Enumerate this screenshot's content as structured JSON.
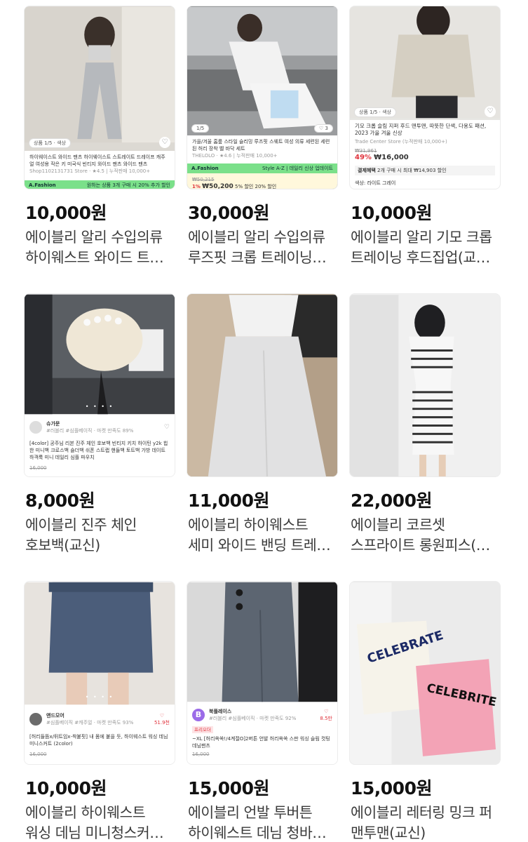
{
  "products": [
    {
      "price": "10,000원",
      "title_line1": "에이블리 알리 수입의류",
      "title_line2": "하이웨스트 와이드 트…",
      "thumb": {
        "badge": "상품 1/5",
        "badge_sub": "색상",
        "desc": "하이웨이스트 와이드 팬츠 하이웨이스트 스트레이트 드레이프 캐주얼 여성용 작은 키 미국식 빈티지 와이드 팬츠 와이드 팬츠",
        "shop": "Shop1102131731 Store",
        "rating": "4.5",
        "sold": "누적판매 10,000+",
        "bar_left": "A.Fashion",
        "bar_right": "원하는 상품 3개 구매 시 20% 추가 할인"
      },
      "colors": {
        "bg": "#d9d6d0",
        "fg": "#b9bcc0"
      }
    },
    {
      "price": "30,000원",
      "title_line1": "에이블리 알리 수입의류",
      "title_line2": "루즈핏 크롭 트레이닝…",
      "thumb": {
        "badge": "1/5",
        "likes": "3",
        "desc": "가을/겨울 홈룸 스타일 슬리밍 루즈핏 스웨트 여성 의류 세련된 세련된 허리 장착 벨 바닥 세트",
        "shop": "THELOLO",
        "rating": "4.6",
        "sold": "누적판매 10,000+",
        "bar_left": "A.Fashion",
        "bar_right": "Style A-Z | 데일리 신상 업데이트",
        "old_price": "₩50,215",
        "discount": "1%",
        "new_price": "₩50,200",
        "coupon": "5% 할인",
        "coupon2": "20% 할인"
      },
      "colors": {
        "bg": "#8d8f91",
        "fg": "#ececec"
      }
    },
    {
      "price": "10,000원",
      "title_line1": "에이블리 알리 기모 크롭",
      "title_line2": "트레이닝 후드집업(교…",
      "thumb": {
        "badge": "상품 1/5",
        "badge_sub": "색상",
        "desc": "기모 크롭 슬림 지퍼 후드 맨투맨, 따뜻한 단색, 다용도 패션, 2023 가을 겨울 신상",
        "shop": "Trade Center Store",
        "sold": "누적판매 10,000+",
        "old_price": "₩31,961",
        "discount": "49%",
        "new_price": "₩16,000",
        "promo": "결제혜택",
        "promo_detail": "2개 구매 시 최대 ₩14,903 할인",
        "color_label": "색상: 라이트 그레이"
      },
      "colors": {
        "bg": "#e8e7e4",
        "fg": "#d6d0c4"
      }
    },
    {
      "price": "8,000원",
      "title_line1": "에이블리 진주 체인",
      "title_line2": "호보백(교신)",
      "thumb": {
        "shop": "슈가문",
        "tags": "#러블리 #심플베이직 · 마켓 만족도 89%",
        "desc": "[4color] 공주님 리본 진주 체인 호보백 빈티지 키치 하이틴 y2k 힙한 미니백 크로스백 숄더백 쉬폰 스트랩 핸들백 토트백 가방 데이트 하객룩 미니 데일리 심플 파우치",
        "old_price": "16,000"
      },
      "colors": {
        "bg": "#3b3d41",
        "fg": "#efe9dc"
      }
    },
    {
      "price": "11,000원",
      "title_line1": "에이블리 하이웨스트",
      "title_line2": "세미 와이드 밴딩 트레…",
      "thumb": {},
      "colors": {
        "bg": "#c9b69f",
        "fg": "#e4e4e4"
      }
    },
    {
      "price": "22,000원",
      "title_line1": "에이블리 코르셋",
      "title_line2": "스프라이트 롱원피스(…",
      "thumb": {},
      "colors": {
        "bg": "#f1f1f1",
        "fg": "#3a3a3a"
      }
    },
    {
      "price": "10,000원",
      "title_line1": "에이블리 하이웨스트",
      "title_line2": "워싱 데님 미니청스커…",
      "thumb": {
        "shop": "앤드모어",
        "tags": "#심플베이직 #캐주얼 · 마켓 만족도 93%",
        "likes": "51.9천",
        "desc": "[허리들뜸x/뒤트임x-착붙핏] 내 몸에 붙을 듯, 하이웨스트 워싱 데님 미니스커트 (2color)",
        "old_price": "16,000"
      },
      "colors": {
        "bg": "#e6e3df",
        "fg": "#4a5c78"
      }
    },
    {
      "price": "15,000원",
      "title_line1": "에이블리 언발 투버튼",
      "title_line2": "하이웨스트 데님 청바…",
      "thumb": {
        "shop": "북플레이스",
        "tags": "#러블리 #심플베이직 · 마켓 만족도 92%",
        "likes": "8.5만",
        "label": "프리오더",
        "desc": "~XL [허리쏙쏙!/4계절O]2버튼 언발 허리쏙쏙 스판 워싱 슬림 컷팅 데님팬츠",
        "old_price": "16,000"
      },
      "colors": {
        "bg": "#d8d8d8",
        "fg": "#5b6470"
      }
    },
    {
      "price": "15,000원",
      "title_line1": "에이블리 레터링 밍크 퍼",
      "title_line2": "맨투맨(교신)",
      "thumb": {
        "print1": "CELEBRATE",
        "print2": "CELEBRITE"
      },
      "colors": {
        "bg": "#ececec",
        "fg": "#f3a6b9"
      }
    }
  ]
}
